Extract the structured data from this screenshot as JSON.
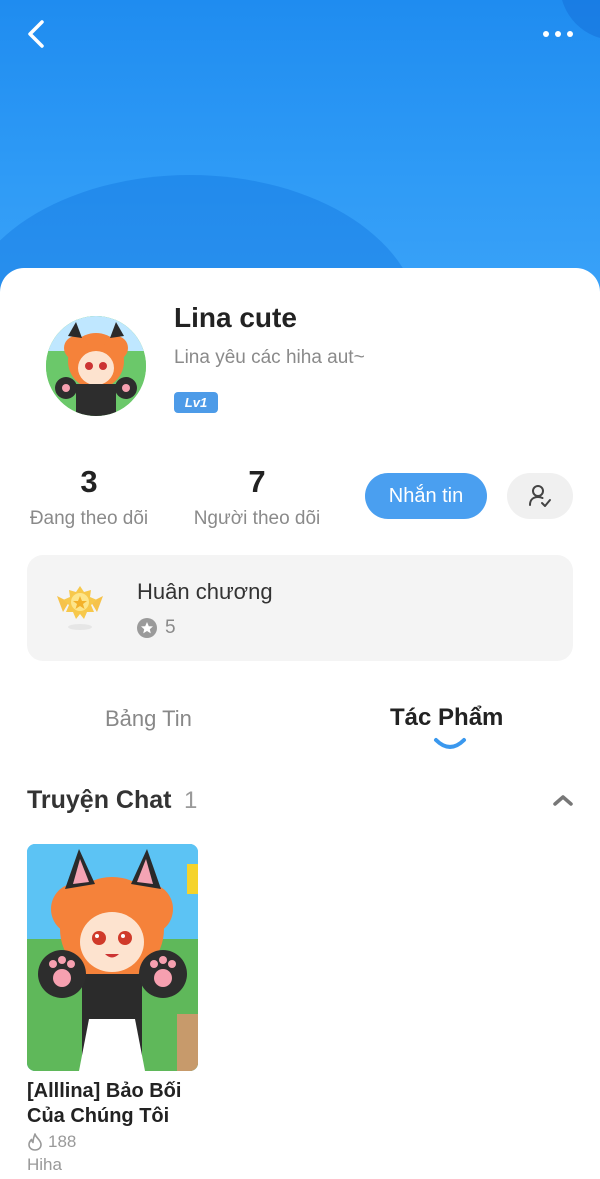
{
  "header": {
    "back_icon": "chevron-left-icon",
    "more_icon": "more-dots-icon",
    "bg_color": "#2f9bf6"
  },
  "profile": {
    "name": "Lina cute",
    "bio": "Lina yêu các hiha aut~",
    "level": "Lv1",
    "avatar_icon": "avatar-image"
  },
  "stats": {
    "following_count": "3",
    "following_label": "Đang theo dõi",
    "followers_count": "7",
    "followers_label": "Người theo dõi"
  },
  "actions": {
    "message_label": "Nhắn tin",
    "message_color": "#4a9ff0",
    "follow_icon": "user-check-icon"
  },
  "medals": {
    "title": "Huân chương",
    "count": "5"
  },
  "tabs": [
    {
      "label": "Bảng Tin",
      "active": false
    },
    {
      "label": "Tác Phẩm",
      "active": true
    }
  ],
  "section": {
    "title": "Truyện Chat",
    "count": "1",
    "collapse_icon": "chevron-up-icon"
  },
  "stories": [
    {
      "title": "[Alllina] Bảo Bối Của Chúng Tôi",
      "views": "188",
      "author": "Hiha",
      "views_icon": "flame-icon"
    }
  ]
}
